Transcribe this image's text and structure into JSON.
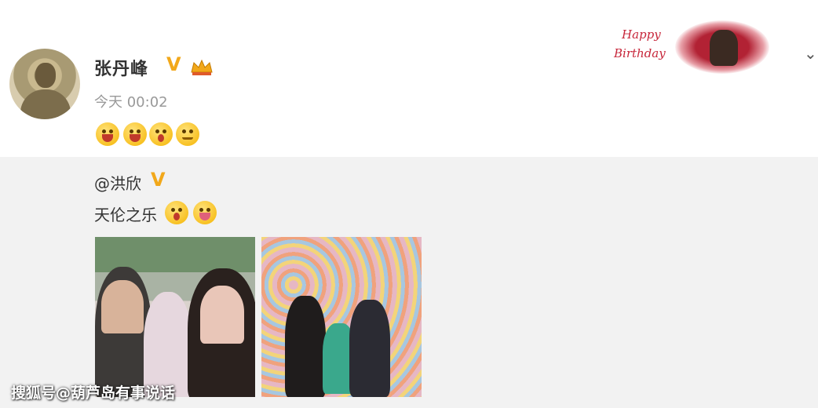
{
  "post": {
    "username": "张丹峰",
    "verified_badge": "V",
    "timestamp": "今天 00:02",
    "emojis": [
      "laugh-emoji",
      "laugh-emoji",
      "awkward-emoji",
      "wink-emoji"
    ]
  },
  "header_card": {
    "greeting_line1": "Happy",
    "greeting_line2": "Birthday"
  },
  "repost": {
    "mention": "@洪欣",
    "verified_badge": "V",
    "text": "天伦之乐"
  },
  "watermark": "搜狐号@葫芦岛有事说话",
  "colors": {
    "badge": "#f2a81a",
    "repost_bg": "#f2f2f2",
    "birthday_red": "#c7263a"
  }
}
